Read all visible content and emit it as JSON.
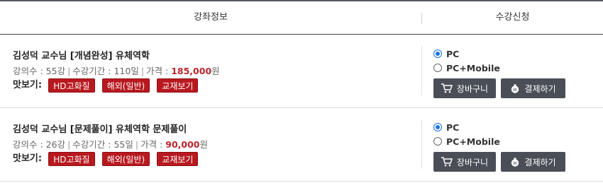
{
  "header": {
    "course_info": "강좌정보",
    "enroll": "수강신청"
  },
  "courses": [
    {
      "title": "김성덕 교수님 [개념완성] 유체역학",
      "lectures": "강의수 : 55강",
      "period": "수강기간 : 110일",
      "price_label": "가격 : ",
      "price": "185,000",
      "won": "원",
      "preview_label": "맛보기:",
      "preview_hd": "HD고화질",
      "preview_overseas": "해외(일반)",
      "preview_textbook": "교재보기",
      "option_pc": "PC",
      "option_pc_mobile": "PC+Mobile",
      "selected_option": "PC",
      "cart": "장바구니",
      "pay": "결제하기"
    },
    {
      "title": "김성덕 교수님 [문제풀이] 유체역학 문제풀이",
      "lectures": "강의수 : 26강",
      "period": "수강기간 : 55일",
      "price_label": "가격 : ",
      "price": "90,000",
      "won": "원",
      "preview_label": "맛보기:",
      "preview_hd": "HD고화질",
      "preview_overseas": "해외(일반)",
      "preview_textbook": "교재보기",
      "option_pc": "PC",
      "option_pc_mobile": "PC+Mobile",
      "selected_option": "PC",
      "cart": "장바구니",
      "pay": "결제하기"
    }
  ],
  "colors": {
    "accent_red": "#b8191f",
    "button_dark": "#4a4f57",
    "radio_blue": "#1a73e8"
  },
  "icons": {
    "cart": "cart-icon",
    "pay": "money-bag-icon"
  }
}
